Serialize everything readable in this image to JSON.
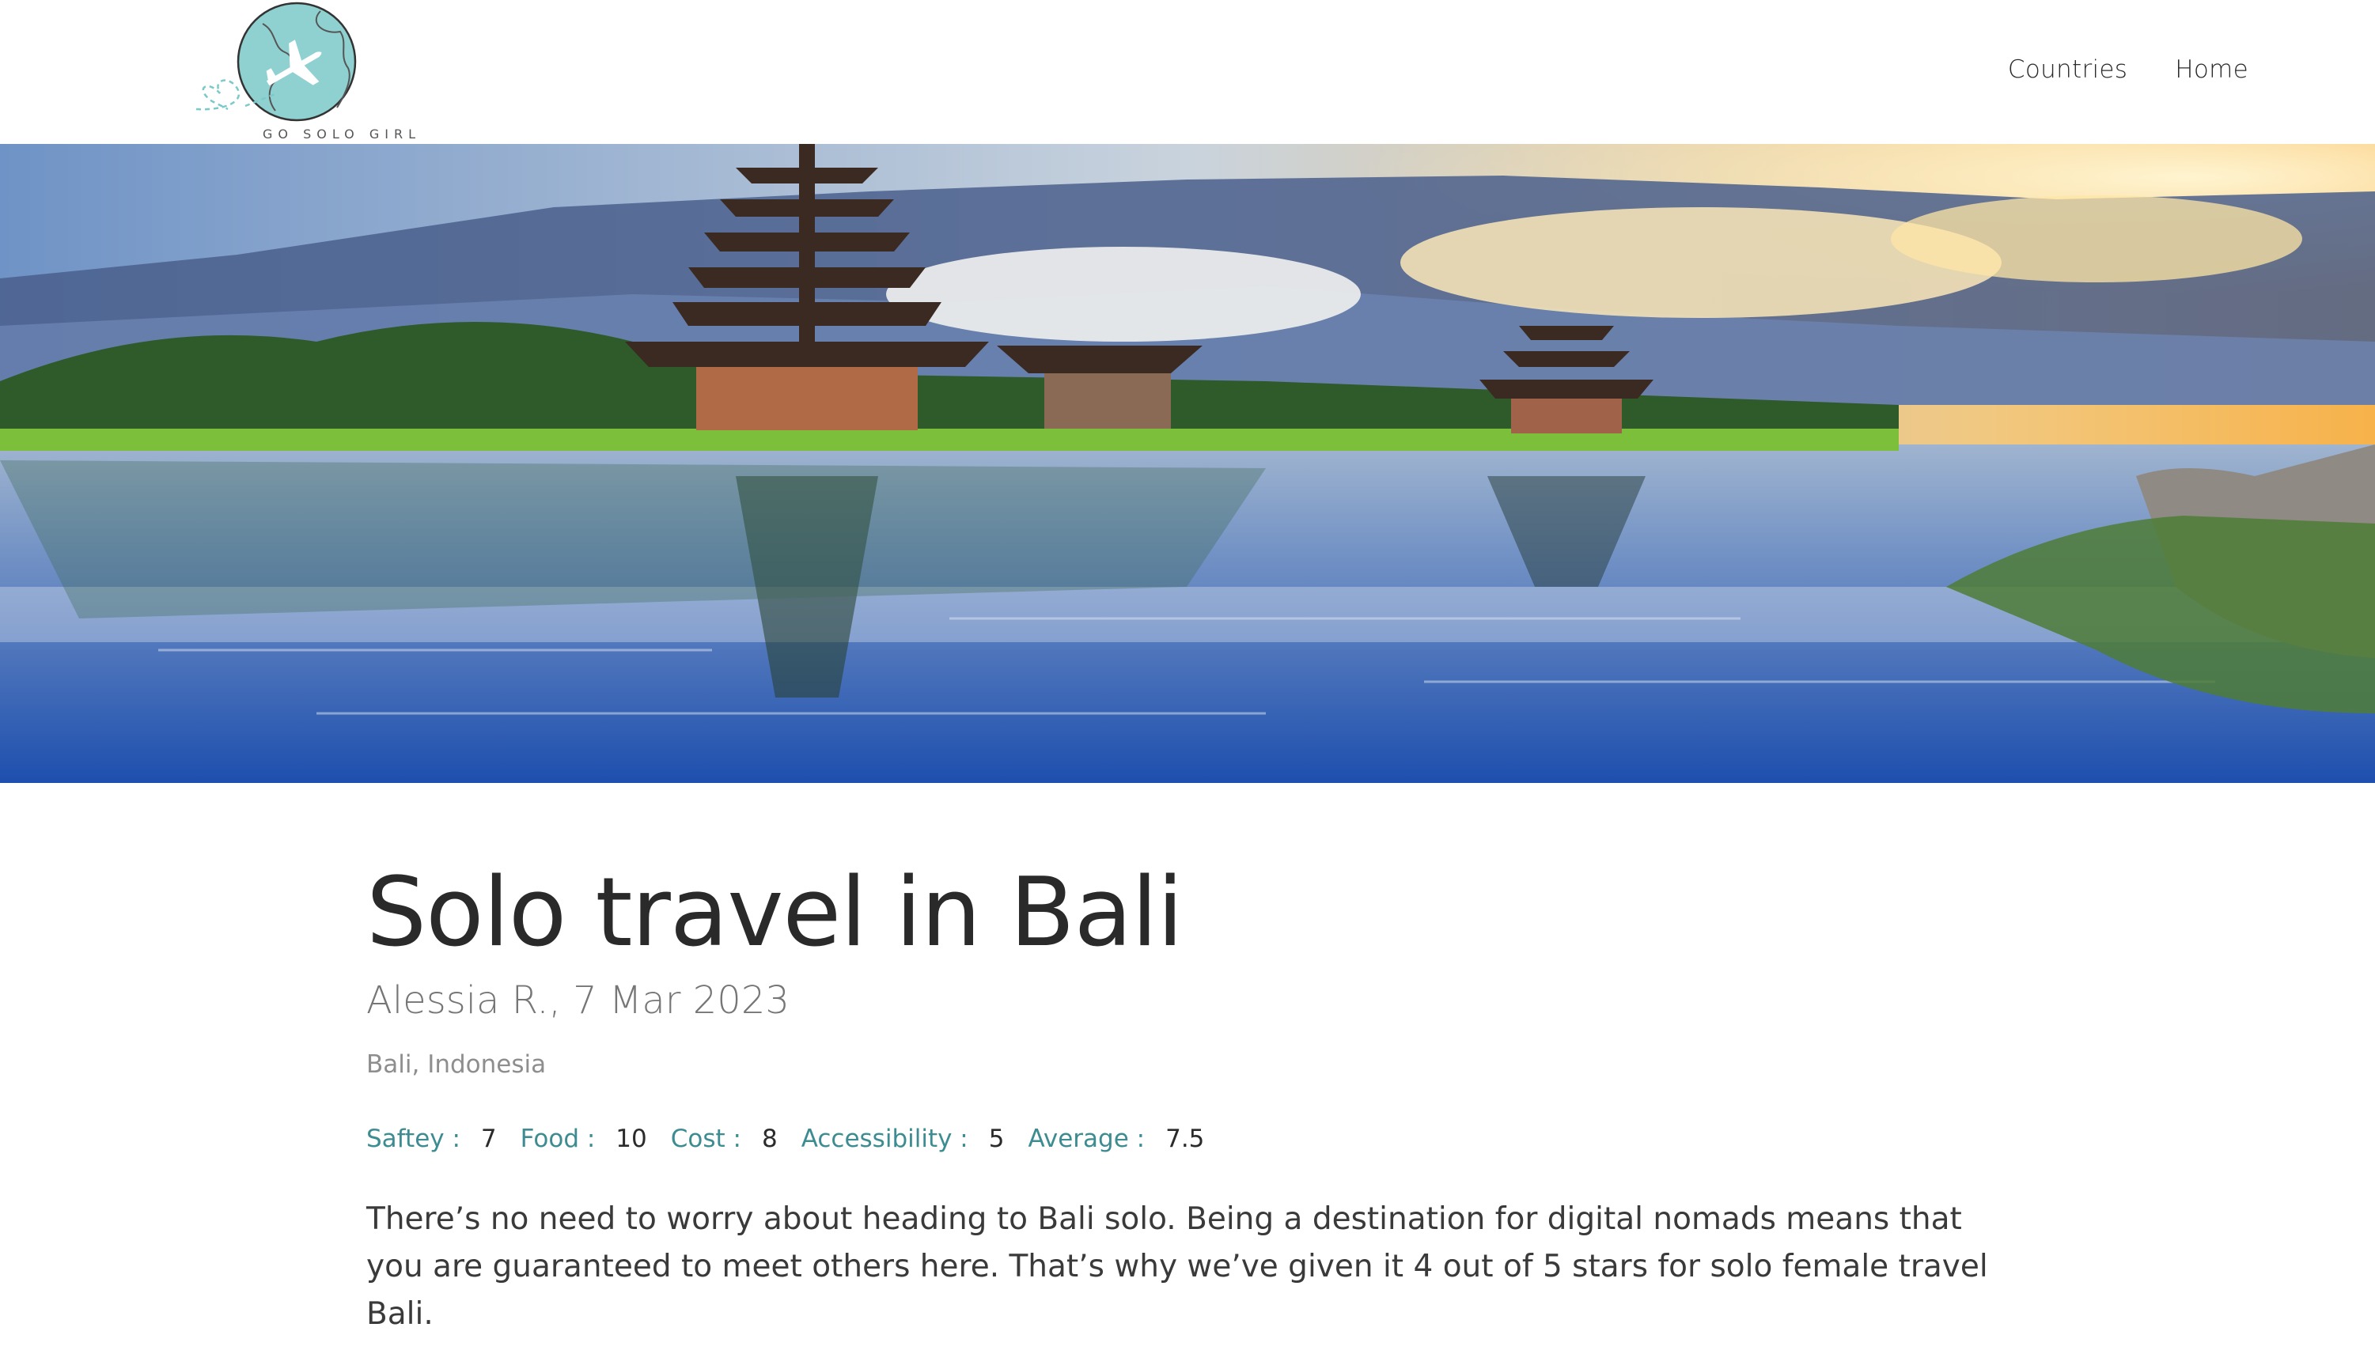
{
  "brand": {
    "logo_text": "GO SOLO GIRL",
    "colors": {
      "globe": "#8fd0d0",
      "accent_teal": "#3d8c91",
      "title": "#2a2a2a"
    }
  },
  "nav": {
    "items": [
      {
        "label": "Countries"
      },
      {
        "label": "Home"
      }
    ]
  },
  "hero": {
    "icon": "lake-temple-photo"
  },
  "article": {
    "title": "Solo travel in Bali",
    "byline": "Alessia R., 7 Mar 2023",
    "location": "Bali, Indonesia",
    "ratings": [
      {
        "label": "Saftey :",
        "value": "7"
      },
      {
        "label": "Food :",
        "value": "10"
      },
      {
        "label": "Cost :",
        "value": "8"
      },
      {
        "label": "Accessibility :",
        "value": "5"
      },
      {
        "label": "Average :",
        "value": "7.5"
      }
    ],
    "body": "There’s no need to worry about heading to Bali solo. Being a destination for digital nomads means that you are guaranteed to meet others here. That’s why we’ve given it 4 out of 5 stars for solo female travel Bali."
  }
}
